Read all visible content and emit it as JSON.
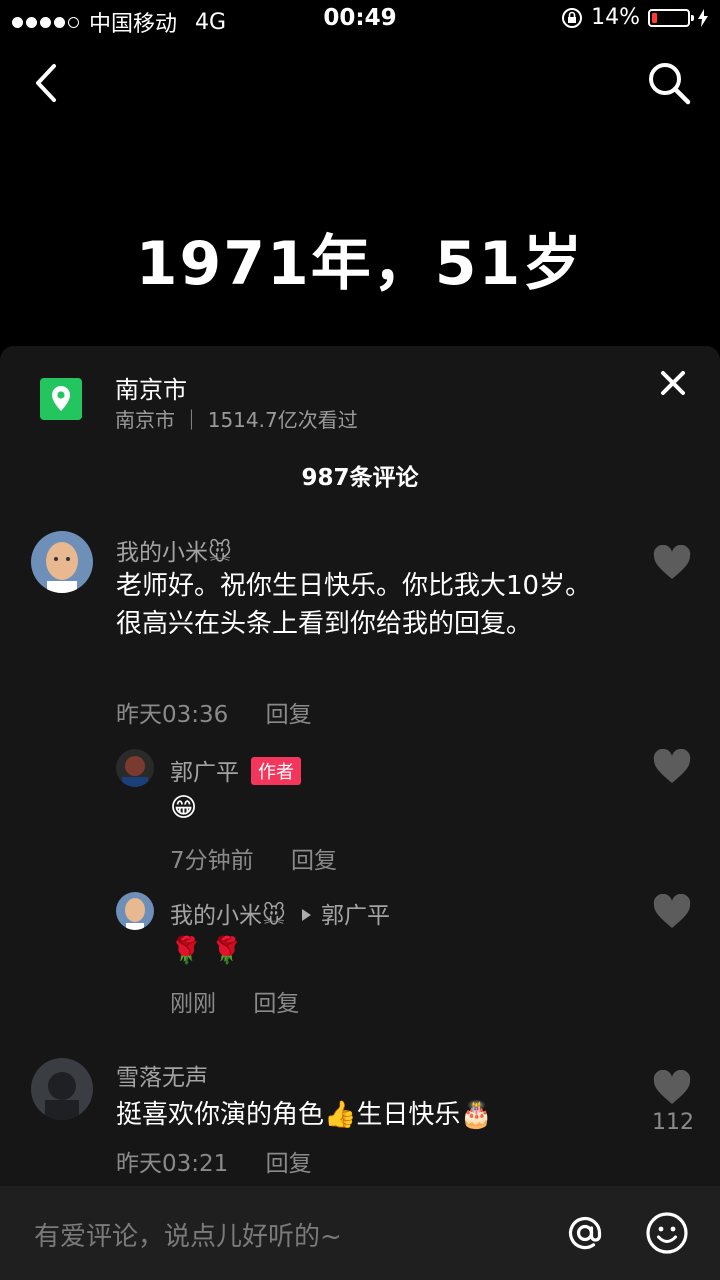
{
  "status": {
    "carrier": "中国移动",
    "network": "4G",
    "time": "00:49",
    "battery_percent": "14%",
    "battery_level": 0.14
  },
  "hero_text": "1971年，51岁",
  "sheet": {
    "location_title": "南京市",
    "location_sub": "南京市 ｜ 1514.7亿次看过",
    "comment_count": "987条评论",
    "comments": [
      {
        "user": "我的小米🐭",
        "text": "老师好。祝你生日快乐。你比我大10岁。很高兴在头条上看到你给我的回复。",
        "time": "昨天03:36",
        "reply": "回复"
      },
      {
        "user": "郭广平",
        "badge": "作者",
        "text": "😁",
        "time": "7分钟前",
        "reply": "回复"
      },
      {
        "user": "我的小米🐭",
        "reply_to": "郭广平",
        "text": "🌹 🌹",
        "time": "刚刚",
        "reply": "回复"
      },
      {
        "user": "雪落无声",
        "text": "挺喜欢你演的角色👍生日快乐🎂",
        "time": "昨天03:21",
        "reply": "回复",
        "likes": "112"
      }
    ]
  },
  "input": {
    "placeholder": "有爱评论，说点儿好听的~"
  },
  "colors": {
    "accent": "#f5365c",
    "location": "#22c55e",
    "sheet_bg": "#161616"
  },
  "icons": [
    "back-icon",
    "search-icon",
    "location-pin-icon",
    "close-icon",
    "heart-icon",
    "at-icon",
    "emoji-icon"
  ]
}
